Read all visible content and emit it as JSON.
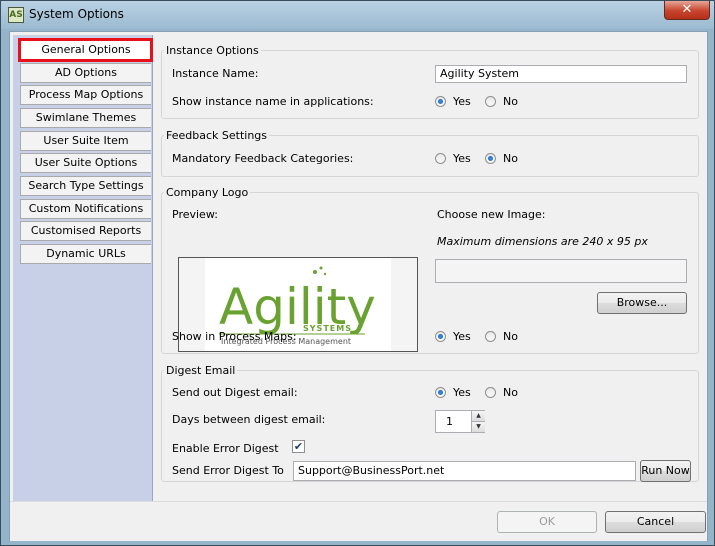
{
  "window": {
    "title": "System Options",
    "icon_label": "AS",
    "close_label": "✕"
  },
  "sidebar": {
    "items": [
      {
        "label": "General Options",
        "active": true
      },
      {
        "label": "AD Options"
      },
      {
        "label": "Process Map Options"
      },
      {
        "label": "Swimlane Themes"
      },
      {
        "label": "User Suite Item Options"
      },
      {
        "label": "User Suite Options"
      },
      {
        "label": "Search Type Settings"
      },
      {
        "label": "Custom Notifications"
      },
      {
        "label": "Customised Reports"
      },
      {
        "label": "Dynamic URLs"
      }
    ]
  },
  "instance": {
    "group_title": "Instance Options",
    "name_label": "Instance Name:",
    "name_value": "Agility System",
    "show_label": "Show instance name in applications:",
    "yes": "Yes",
    "no": "No",
    "selected": "Yes"
  },
  "feedback": {
    "group_title": "Feedback Settings",
    "mandatory_label": "Mandatory Feedback Categories:",
    "yes": "Yes",
    "no": "No",
    "selected": "No"
  },
  "logo": {
    "group_title": "Company Logo",
    "preview_label": "Preview:",
    "choose_label": "Choose new Image:",
    "max_dims": "Maximum dimensions are 240 x 95 px",
    "file_path": "",
    "browse_label": "Browse...",
    "show_label": "Show in Process Maps:",
    "yes": "Yes",
    "no": "No",
    "selected": "Yes",
    "logo_text": "Agility",
    "logo_sub": "SYSTEMS",
    "logo_tagline": "Integrated Process Management",
    "logo_color": "#6aa232"
  },
  "digest": {
    "group_title": "Digest Email",
    "send_label": "Send out Digest email:",
    "yes": "Yes",
    "no": "No",
    "selected": "Yes",
    "days_label": "Days between digest email:",
    "days_value": "1",
    "error_digest_label": "Enable Error Digest",
    "error_digest_checked": true,
    "send_to_label": "Send Error Digest To",
    "send_to_value": "Support@BusinessPort.net",
    "run_now_label": "Run Now"
  },
  "footer": {
    "ok_label": "OK",
    "cancel_label": "Cancel"
  }
}
